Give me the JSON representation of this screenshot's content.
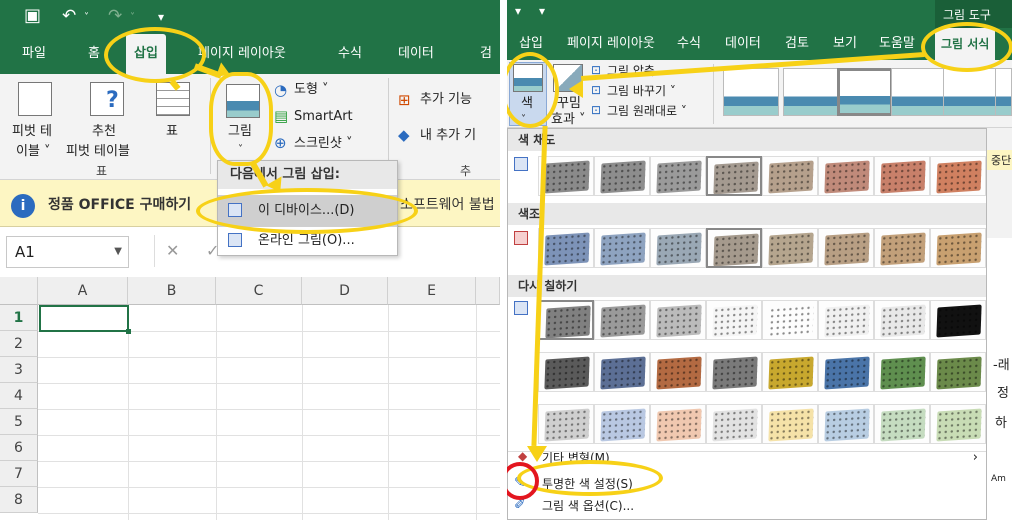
{
  "left": {
    "qat": {
      "save_icon": "save-icon",
      "undo": "↶",
      "redo": "↷"
    },
    "tabs": [
      "파일",
      "홈",
      "삽입",
      "페이지 레이아웃",
      "수식",
      "데이터",
      "검"
    ],
    "selected_tab": "삽입",
    "ribbon": {
      "pivot_label1": "피벗 테",
      "pivot_label2": "이블 ˅",
      "rec_pivot1": "추천",
      "rec_pivot2": "피벗 테이블",
      "table_label": "표",
      "group_table": "표",
      "picture_label": "그림",
      "picture_chevron": "˅",
      "shape_label": "도형 ˅",
      "smartart_label": "SmartArt",
      "screenshot_label": "스크린샷 ˅",
      "addin_label": "추가 기능",
      "my_addin_label": "내 추가 기",
      "group_addin": "추"
    },
    "menu": {
      "header": "다음에서 그림 삽입:",
      "items": [
        "이 디바이스...(D)",
        "온라인 그림(O)..."
      ]
    },
    "infobar": {
      "icon": "i",
      "text": "정품 OFFICE 구매하기",
      "trail": "소프트웨어 불법"
    },
    "namebox": {
      "value": "A1"
    },
    "fx_buttons": [
      "✕",
      "✓"
    ],
    "columns": [
      "A",
      "B",
      "C",
      "D",
      "E"
    ],
    "rows": [
      "1",
      "2",
      "3",
      "4",
      "5",
      "6",
      "7",
      "8"
    ]
  },
  "right": {
    "title": "그림 도구",
    "tabs": [
      "삽입",
      "페이지 레이아웃",
      "수식",
      "데이터",
      "검토",
      "보기",
      "도움말",
      "그림 서식"
    ],
    "selected_tab": "그림 서식",
    "ribbon": {
      "color_label": "색",
      "color_chevron": "˅",
      "artistic1": "꾸밈",
      "artistic2": "효과 ˅",
      "compress": "그림 압축",
      "change": "그림 바꾸기 ˅",
      "reset": "그림 원래대로 ˅"
    },
    "dropdown": {
      "sections": [
        "색 채도",
        "색조",
        "다시 칠하기"
      ],
      "items": [
        "기타 변형(M)",
        "투명한 색 설정(S)",
        "그림 색 옵션(C)..."
      ],
      "item_arrow": "›"
    },
    "side_text": [
      "중단",
      "-래",
      "정",
      "하",
      "Am"
    ]
  },
  "colors": {
    "excel_green": "#217346",
    "highlight": "#f7d117",
    "red": "#e3161f"
  }
}
